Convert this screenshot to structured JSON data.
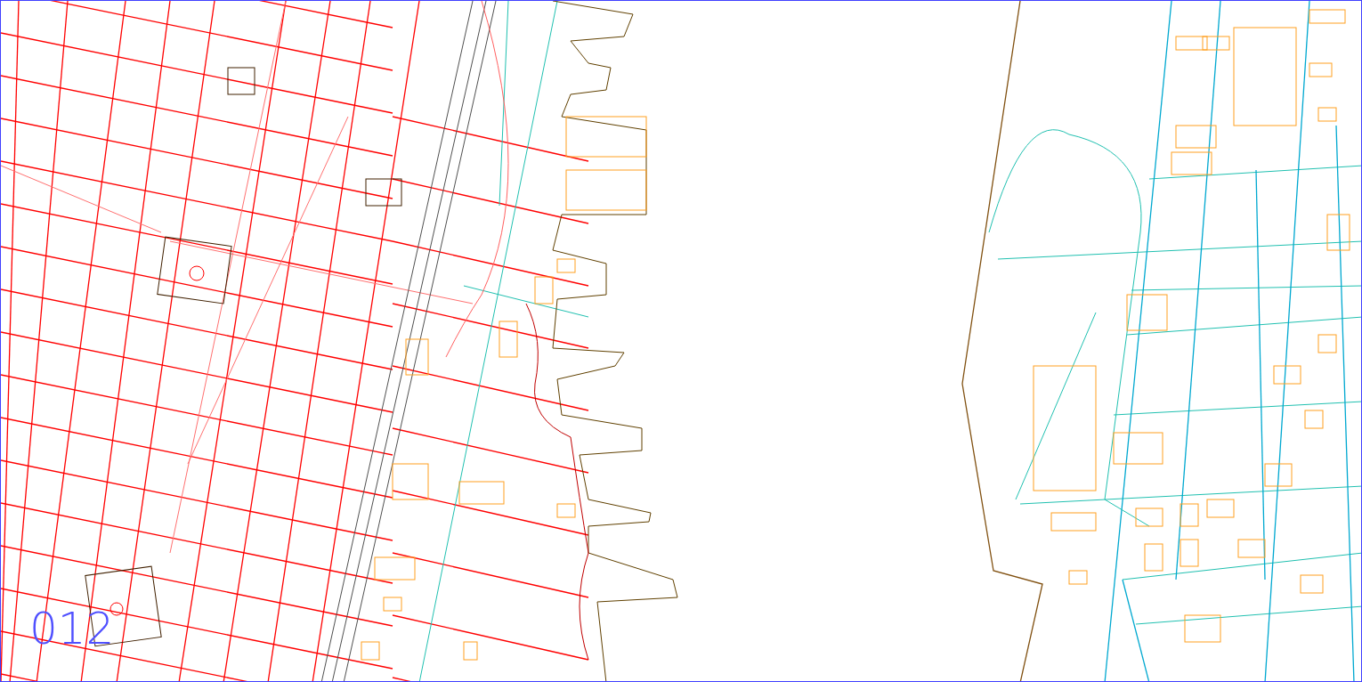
{
  "map": {
    "label": "012"
  }
}
